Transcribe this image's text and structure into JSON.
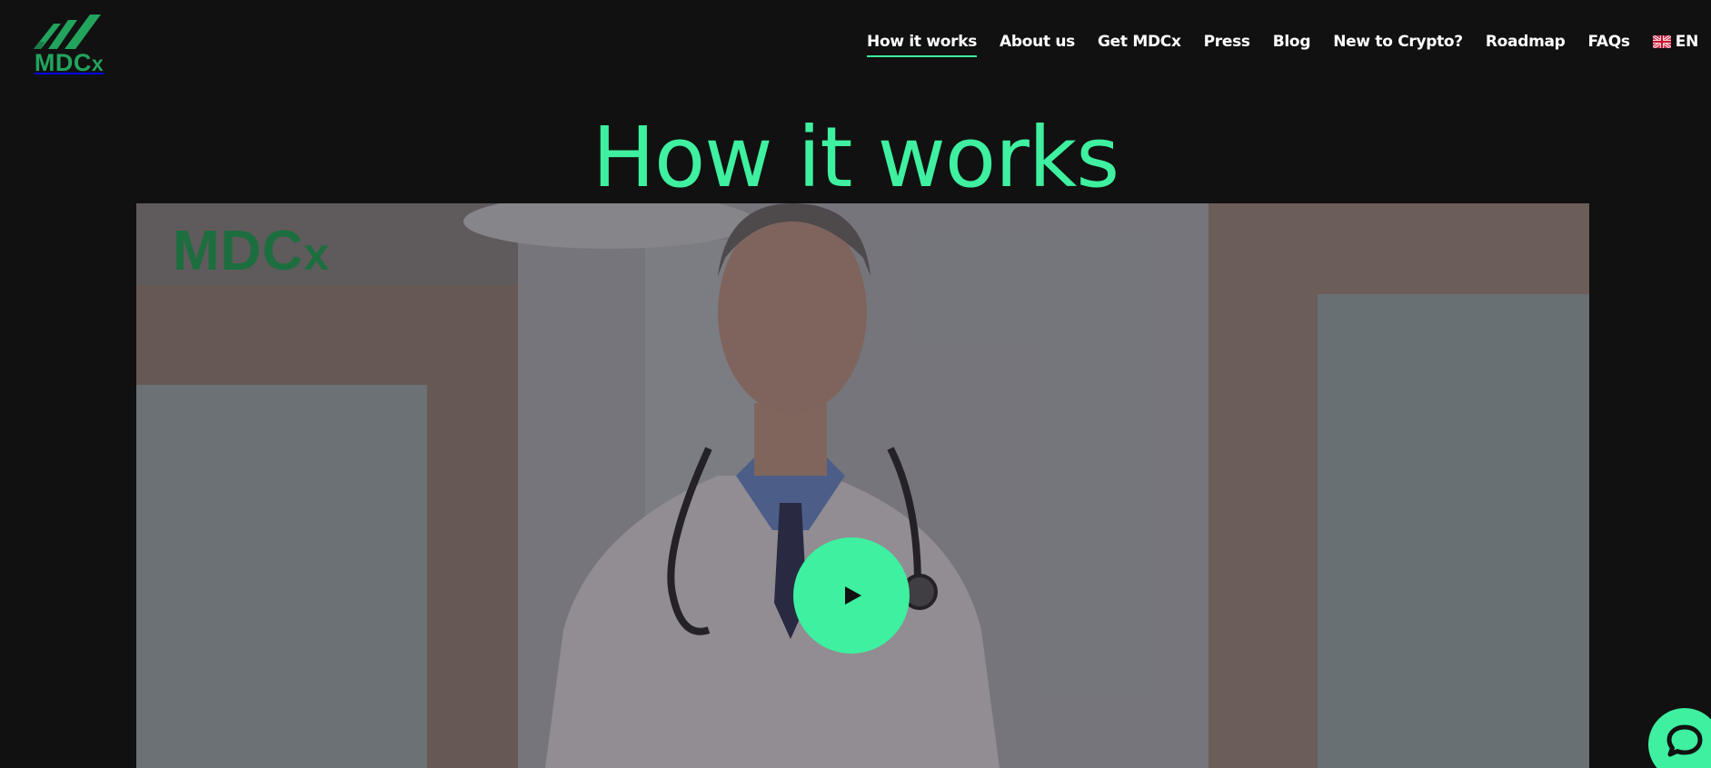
{
  "brand": {
    "logo_text": "MDC",
    "logo_suffix": "x",
    "accent_color": "#3ef0a0",
    "logo_color": "#22a45d"
  },
  "nav": {
    "items": [
      {
        "label": "How it works",
        "active": true
      },
      {
        "label": "About us"
      },
      {
        "label": "Get MDCx"
      },
      {
        "label": "Press"
      },
      {
        "label": "Blog"
      },
      {
        "label": "New to Crypto?"
      },
      {
        "label": "Roadmap"
      },
      {
        "label": "FAQs"
      }
    ],
    "language": {
      "label": "EN",
      "icon": "uk-flag-icon"
    }
  },
  "hero": {
    "title": "How it works"
  },
  "video": {
    "watermark_text": "MDC",
    "watermark_suffix": "x",
    "play_icon": "play-icon"
  },
  "chat": {
    "icon": "chat-bubble-icon"
  }
}
